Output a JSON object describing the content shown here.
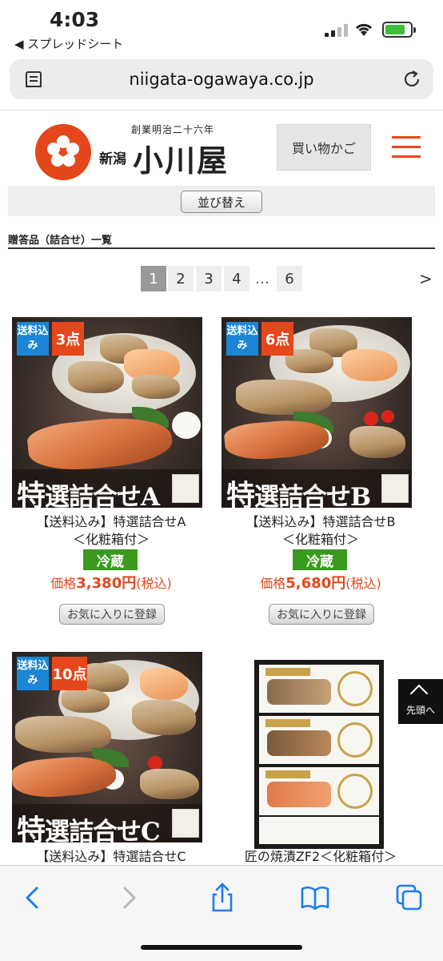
{
  "status_bar": {
    "time": "4:03",
    "back_app": "◀ スプレッドシート"
  },
  "browser": {
    "url": "niigata-ogawaya.co.jp"
  },
  "site_header": {
    "logo_established": "創業明治二十六年",
    "logo_prefix": "新潟",
    "logo_name": "小川屋",
    "cart_label": "買い物かご"
  },
  "sort_label": "並び替え",
  "section_title": "贈答品（詰合せ）一覧",
  "pagination": {
    "pages": [
      "1",
      "2",
      "3",
      "4",
      "…",
      "6"
    ],
    "current": "1",
    "next": ">"
  },
  "products": [
    {
      "badge_shipping": "送料込み",
      "badge_count": "3点",
      "banner_big": "特",
      "banner_rest": "選詰合せA",
      "name_line1": "【送料込み】特選詰合せA",
      "name_line2": "＜化粧箱付＞",
      "storage": "冷蔵",
      "price_label": "価格",
      "price": "3,380円",
      "tax": "(税込)",
      "fav_label": "お気に入りに登録"
    },
    {
      "badge_shipping": "送料込み",
      "badge_count": "6点",
      "banner_big": "特",
      "banner_rest": "選詰合せB",
      "name_line1": "【送料込み】特選詰合せB",
      "name_line2": "＜化粧箱付＞",
      "storage": "冷蔵",
      "price_label": "価格",
      "price": "5,680円",
      "tax": "(税込)",
      "fav_label": "お気に入りに登録"
    },
    {
      "badge_shipping": "送料込み",
      "badge_count": "10点",
      "banner_big": "特",
      "banner_rest": "選詰合せC",
      "name_line1": "【送料込み】特選詰合せC"
    },
    {
      "name_line1": "匠の焼漬ZF2＜化粧箱付＞"
    }
  ],
  "to_top_label": "先頭へ",
  "colors": {
    "brand": "#e5471c",
    "cold_badge": "#3a9a1e",
    "shipping_badge": "#1b86d6",
    "ios_blue": "#1a7cf5"
  }
}
